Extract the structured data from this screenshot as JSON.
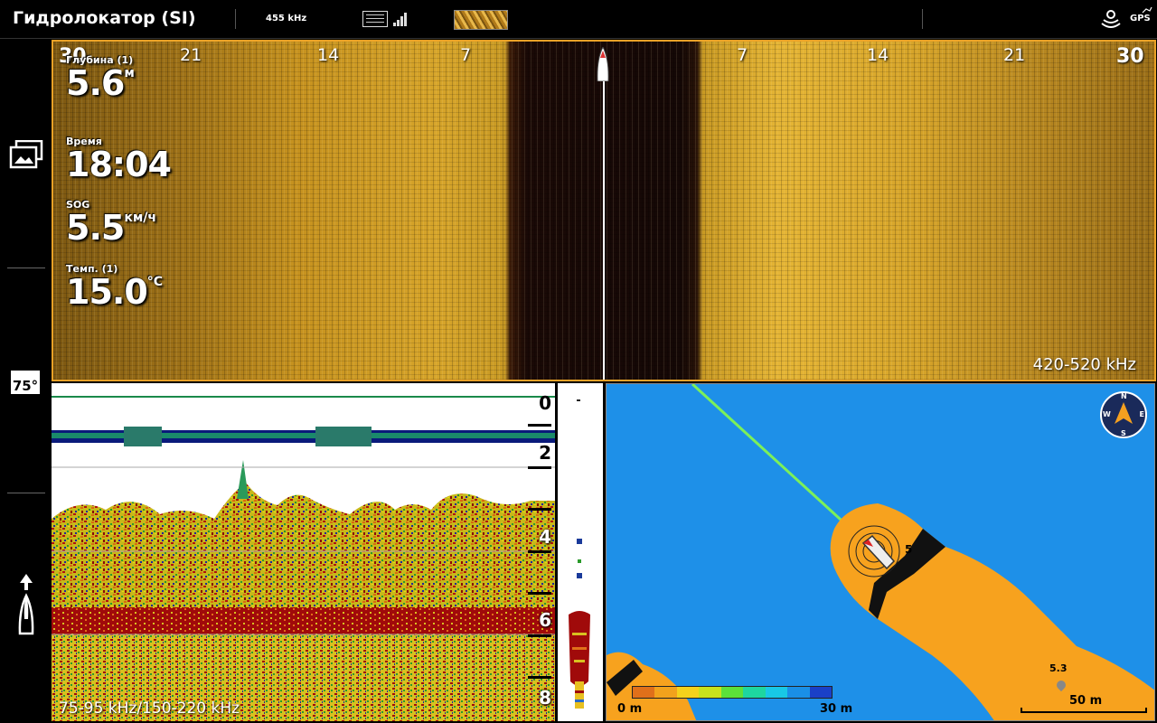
{
  "topbar": {
    "title": "Гидролокатор (SI)",
    "frequency": "455 kHz",
    "gps_label": "GPS"
  },
  "sidebar": {
    "temp_badge": "75°"
  },
  "side_imaging": {
    "ranges_left": [
      "30",
      "21",
      "14",
      "7"
    ],
    "ranges_right": [
      "7",
      "14",
      "21",
      "30"
    ],
    "frequency_label": "420-520 kHz"
  },
  "data_boxes": {
    "depth": {
      "label": "Глубина (1)",
      "value": "5.6",
      "unit": "м"
    },
    "time": {
      "label": "Время",
      "value": "18:04"
    },
    "sog": {
      "label": "SOG",
      "value": "5.5",
      "unit": "км/ч"
    },
    "temp": {
      "label": "Темп. (1)",
      "value": "15.0",
      "unit": "°C"
    }
  },
  "sonar": {
    "frequency_label": "75-95 kHz/150-220 kHz",
    "depth_scale": [
      "0",
      "2",
      "4",
      "6",
      "8"
    ]
  },
  "map": {
    "depth_marker": "5.3",
    "scale_label": "50 m",
    "contour_label": "5",
    "legend_min": "0 m",
    "legend_max": "30 m",
    "compass": {
      "n": "N",
      "e": "E",
      "s": "S",
      "w": "W"
    },
    "legend_colors": [
      "#e0701a",
      "#f2a21c",
      "#f5d21c",
      "#c8e21c",
      "#5ce03a",
      "#1ed6a0",
      "#18c8e6",
      "#1a8fe6",
      "#1a40c8"
    ]
  },
  "colors": {
    "accent": "#e9a127",
    "land": "#f7a21e",
    "water": "#1e90e8"
  }
}
